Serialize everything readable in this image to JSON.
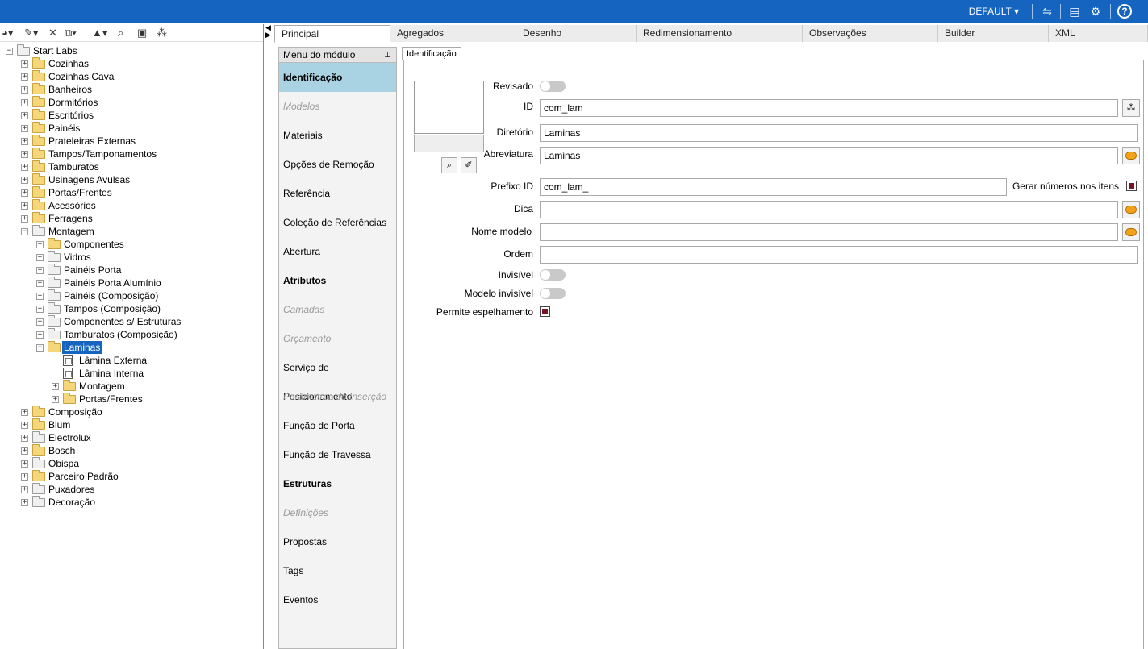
{
  "topbar": {
    "profile": "DEFAULT",
    "icons": [
      "dropdown-caret-icon",
      "network-icon",
      "layout-icon",
      "settings-icon",
      "help-icon"
    ]
  },
  "tree": {
    "root": "Start Labs",
    "items": [
      {
        "label": "Cozinhas"
      },
      {
        "label": "Cozinhas Cava"
      },
      {
        "label": "Banheiros"
      },
      {
        "label": "Dormitórios"
      },
      {
        "label": "Escritórios"
      },
      {
        "label": "Painéis"
      },
      {
        "label": "Prateleiras Externas"
      },
      {
        "label": "Tampos/Tamponamentos"
      },
      {
        "label": "Tamburatos"
      },
      {
        "label": "Usinagens Avulsas"
      },
      {
        "label": "Portas/Frentes"
      },
      {
        "label": "Acessórios"
      },
      {
        "label": "Ferragens"
      },
      {
        "label": "Montagem"
      }
    ],
    "montagem_children": [
      {
        "label": "Componentes"
      },
      {
        "label": "Vidros"
      },
      {
        "label": "Painéis Porta"
      },
      {
        "label": "Painéis Porta Alumínio"
      },
      {
        "label": "Painéis (Composição)"
      },
      {
        "label": "Tampos (Composição)"
      },
      {
        "label": "Componentes s/ Estruturas"
      },
      {
        "label": "Tamburatos (Composição)"
      },
      {
        "label": "Laminas"
      }
    ],
    "laminas_children": [
      {
        "label": "Lâmina Externa"
      },
      {
        "label": "Lâmina Interna"
      },
      {
        "label": "Montagem"
      },
      {
        "label": "Portas/Frentes"
      }
    ],
    "items_after": [
      {
        "label": "Composição"
      },
      {
        "label": "Blum"
      },
      {
        "label": "Electrolux"
      },
      {
        "label": "Bosch"
      },
      {
        "label": "Obispa"
      },
      {
        "label": "Parceiro Padrão"
      },
      {
        "label": "Puxadores"
      },
      {
        "label": "Decoração"
      }
    ]
  },
  "tabs": [
    "Principal",
    "Agregados",
    "Desenho",
    "Redimensionamento",
    "Observações",
    "Builder",
    "XML"
  ],
  "module_menu": {
    "title": "Menu do módulo",
    "items": [
      "Identificação",
      "Modelos",
      "Materiais",
      "Opções de Remoção",
      "Referência",
      "Coleção de Referências",
      "Abertura",
      "Atributos",
      "Camadas",
      "Orçamento",
      "Serviço de Posicionamento",
      "Parâmetros de Inserção",
      "Função de Porta",
      "Função de Travessa",
      "Estruturas",
      "Definições",
      "Propostas",
      "Tags",
      "Eventos"
    ]
  },
  "identification": {
    "subtab": "Identificação",
    "labels": {
      "revisado": "Revisado",
      "id": "ID",
      "diretorio": "Diretório",
      "abreviatura": "Abreviatura",
      "prefixo": "Prefixo ID",
      "gerar": "Gerar números nos itens",
      "dica": "Dica",
      "nome_modelo": "Nome modelo",
      "ordem": "Ordem",
      "invisivel": "Invisível",
      "modelo_invisivel": "Modelo invisível",
      "permite": "Permite espelhamento"
    },
    "values": {
      "id": "com_lam",
      "diretorio": "Laminas",
      "abreviatura": "Laminas",
      "prefixo": "com_lam_",
      "dica": "",
      "nome_modelo": "",
      "ordem": ""
    }
  }
}
